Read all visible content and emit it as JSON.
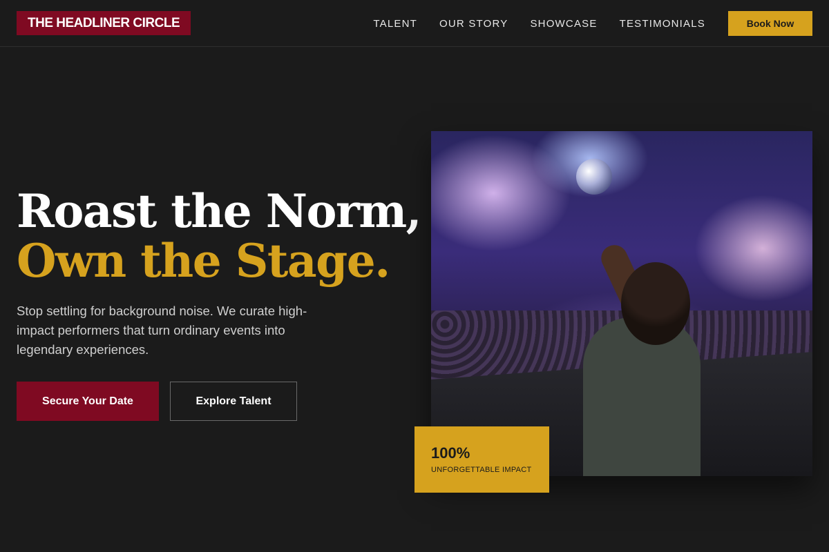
{
  "brand": {
    "name": "THE HEADLINER CIRCLE"
  },
  "nav": {
    "links": [
      "TALENT",
      "OUR STORY",
      "SHOWCASE",
      "TESTIMONIALS"
    ],
    "cta": "Book Now"
  },
  "hero": {
    "title_line1": "Roast the Norm,",
    "title_line2": "Own the Stage.",
    "subtitle": "Stop settling for background noise. We curate high-impact performers that turn ordinary events into legendary experiences.",
    "primary_button": "Secure Your Date",
    "secondary_button": "Explore Talent"
  },
  "stat": {
    "value": "100%",
    "label": "UNFORGETTABLE IMPACT"
  },
  "colors": {
    "background": "#1b1b1b",
    "brand_red": "#7f0a22",
    "accent_gold": "#d6a21e"
  },
  "icons": {
    "hero_image": "dj-performing-image"
  }
}
